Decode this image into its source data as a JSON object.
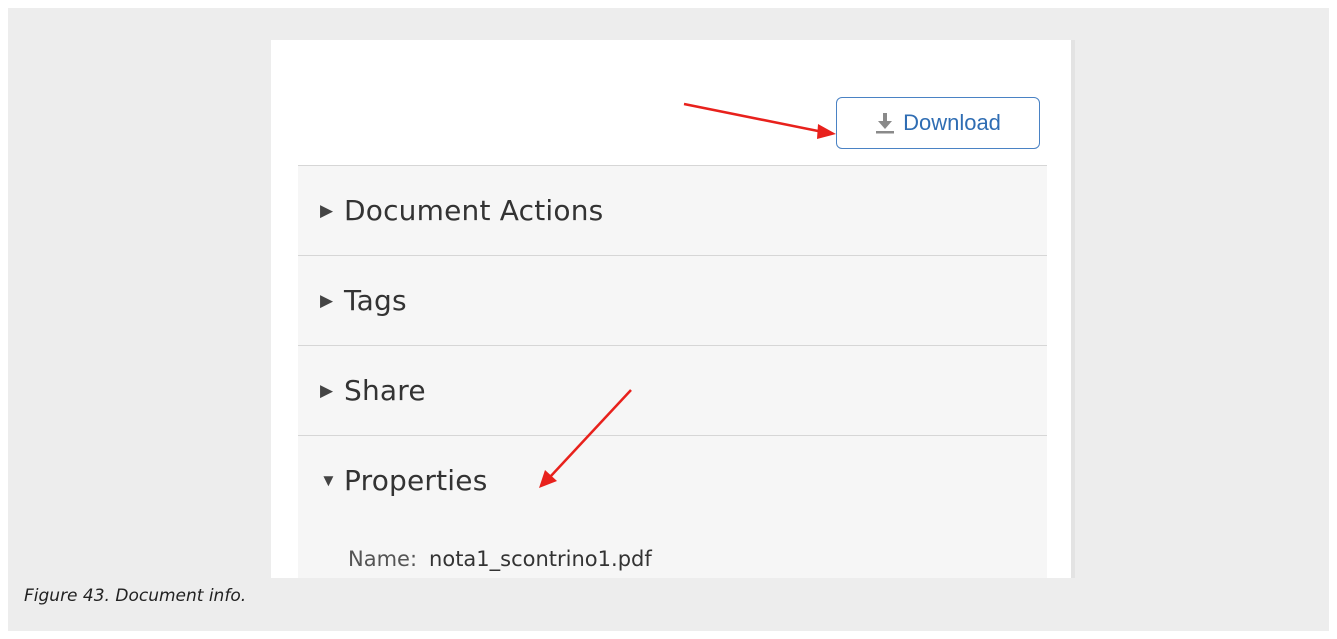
{
  "toolbar": {
    "download_label": "Download",
    "download_icon": "download-icon"
  },
  "sections": [
    {
      "label": "Document Actions",
      "expanded": false,
      "marker": "▶"
    },
    {
      "label": "Tags",
      "expanded": false,
      "marker": "▶"
    },
    {
      "label": "Share",
      "expanded": false,
      "marker": "▶"
    },
    {
      "label": "Properties",
      "expanded": true,
      "marker": "▼"
    }
  ],
  "properties": {
    "name_key": "Name:",
    "name_value": "nota1_scontrino1.pdf"
  },
  "caption": "Figure 43. Document info.",
  "colors": {
    "accent": "#2f6db3",
    "annotation_arrow": "#e8211c",
    "figure_background": "#ededed",
    "panel_background": "#f6f6f6"
  }
}
